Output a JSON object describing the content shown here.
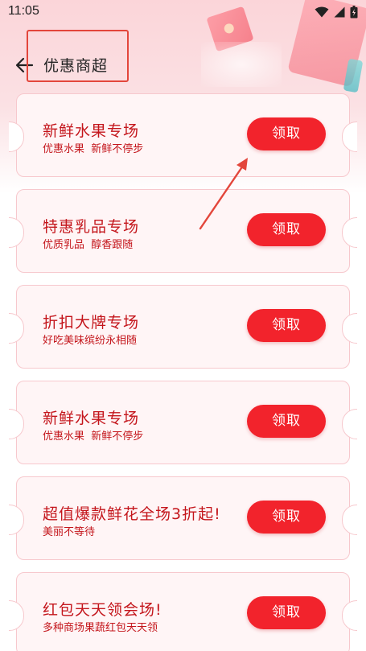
{
  "status_bar": {
    "time": "11:05",
    "icons": [
      "wifi-icon",
      "signal-icon",
      "battery-icon"
    ]
  },
  "header": {
    "title": "优惠商超",
    "back_icon": "arrow-left-icon"
  },
  "coupons": [
    {
      "title": "新鲜水果专场",
      "subtitle": "优惠水果  新鲜不停步",
      "button": "领取"
    },
    {
      "title": "特惠乳品专场",
      "subtitle": "优质乳品  醇香跟随",
      "button": "领取"
    },
    {
      "title": "折扣大牌专场",
      "subtitle": "好吃美味缤纷永相随",
      "button": "领取"
    },
    {
      "title": "新鲜水果专场",
      "subtitle": "优惠水果  新鲜不停步",
      "button": "领取"
    },
    {
      "title": "超值爆款鲜花全场3折起!",
      "subtitle": "美丽不等待",
      "button": "领取"
    },
    {
      "title": "红包天天领会场!",
      "subtitle": "多种商场果蔬红包天天领",
      "button": "领取"
    }
  ],
  "colors": {
    "accent": "#f2232c",
    "title_text": "#c4161c",
    "card_bg": "#fff5f6",
    "card_border": "#f7c8cd",
    "annotation": "#e3463b"
  }
}
